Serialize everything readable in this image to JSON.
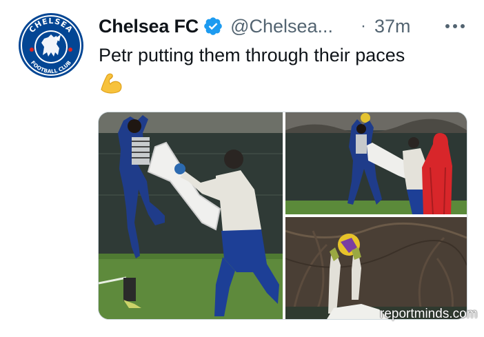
{
  "tweet": {
    "display_name": "Chelsea FC",
    "handle": "@Chelsea...",
    "separator": "·",
    "time": "37m",
    "text": "Petr putting them through their paces",
    "emoji": "flexed-biceps",
    "verified": true
  },
  "avatar": {
    "logo_top_text": "CHELSEA",
    "logo_bottom_text": "FOOTBALL CLUB"
  },
  "media": {
    "count": 3,
    "watermark": "reportminds.com"
  },
  "colors": {
    "text_primary": "#0f1419",
    "text_secondary": "#536471",
    "verified_blue": "#1d9bf0",
    "border": "#cfd9de",
    "chelsea_blue": "#034694"
  },
  "icons": {
    "verified": "verified-badge-icon",
    "more": "more-horizontal-icon"
  }
}
